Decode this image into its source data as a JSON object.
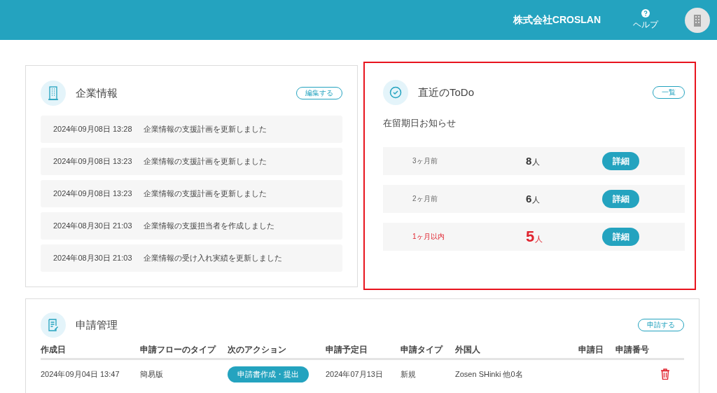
{
  "header": {
    "company": "株式会社CROSLAN",
    "help_label": "ヘルプ"
  },
  "company_panel": {
    "title": "企業情報",
    "button": "編集する",
    "logs": [
      {
        "time": "2024年09月08日 13:28",
        "message": "企業情報の支援計画を更新しました"
      },
      {
        "time": "2024年09月08日 13:23",
        "message": "企業情報の支援計画を更新しました"
      },
      {
        "time": "2024年09月08日 13:23",
        "message": "企業情報の支援計画を更新しました"
      },
      {
        "time": "2024年08月30日 21:03",
        "message": "企業情報の支援担当者を作成しました"
      },
      {
        "time": "2024年08月30日 21:03",
        "message": "企業情報の受け入れ実績を更新しました"
      }
    ]
  },
  "todo_panel": {
    "title": "直近のToDo",
    "button": "一覧",
    "highlighted": true,
    "subtitle": "在留期日お知らせ",
    "rows": [
      {
        "period": "3ヶ月前",
        "count": "8",
        "unit": "人",
        "urgent": false,
        "button": "詳細"
      },
      {
        "period": "2ヶ月前",
        "count": "6",
        "unit": "人",
        "urgent": false,
        "button": "詳細"
      },
      {
        "period": "1ヶ月以内",
        "count": "5",
        "unit": "人",
        "urgent": true,
        "button": "詳細"
      }
    ]
  },
  "applications": {
    "title": "申請管理",
    "button": "申請する",
    "columns": [
      "作成日",
      "申請フローのタイプ",
      "次のアクション",
      "申請予定日",
      "申請タイプ",
      "外国人",
      "申請日",
      "申請番号"
    ],
    "rows": [
      {
        "created": "2024年09月04日 13:47",
        "flow_type": "簡易版",
        "next_action": "申請書作成・提出",
        "planned_date": "2024年07月13日",
        "type": "新規",
        "foreigner": "Zosen SHinki 他0名"
      }
    ]
  }
}
